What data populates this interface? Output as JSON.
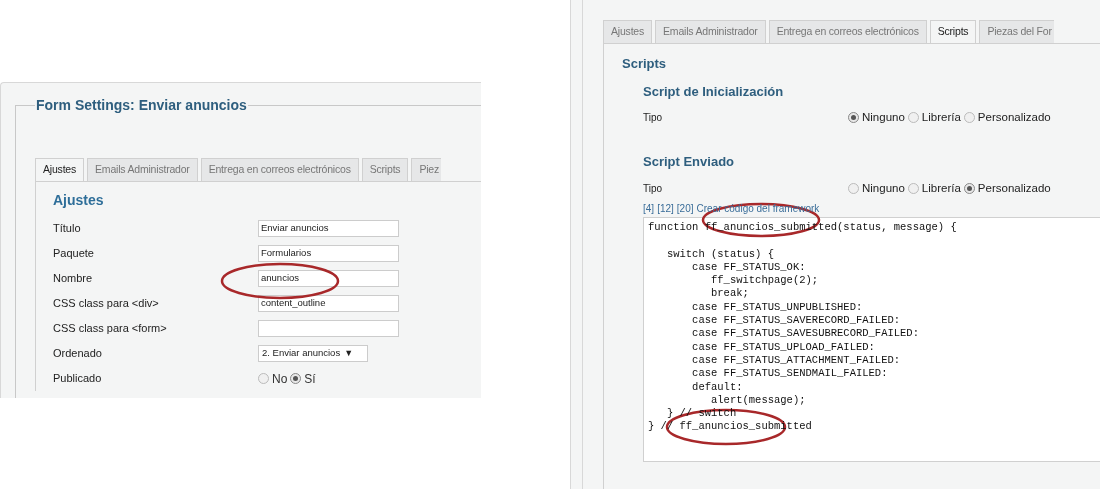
{
  "left_panel": {
    "legend": "Form Settings: Enviar anuncios",
    "tabs": [
      {
        "label": "Ajustes",
        "selected": true
      },
      {
        "label": "Emails Administrador",
        "selected": false
      },
      {
        "label": "Entrega en correos electrónicos",
        "selected": false
      },
      {
        "label": "Scripts",
        "selected": false
      },
      {
        "label": "Piez",
        "selected": false
      }
    ],
    "section_title": "Ajustes",
    "fields": [
      {
        "label": "Título",
        "kind": "text",
        "value": "Enviar anuncios"
      },
      {
        "label": "Paquete",
        "kind": "text",
        "value": "Formularios"
      },
      {
        "label": "Nombre",
        "kind": "text",
        "value": "anuncios"
      },
      {
        "label": "CSS class para <div>",
        "kind": "text",
        "value": "content_outline"
      },
      {
        "label": "CSS class para <form>",
        "kind": "text"
      },
      {
        "label": "Ordenado",
        "kind": "select",
        "value": "2. Enviar anuncios",
        "caret": "▼"
      },
      {
        "label": "Publicado",
        "kind": "radio",
        "options": [
          {
            "label": "No",
            "selected": false
          },
          {
            "label": "Sí",
            "selected": true
          }
        ]
      }
    ]
  },
  "right_panel": {
    "tabs": [
      {
        "label": "Ajustes",
        "selected": false
      },
      {
        "label": "Emails Administrador",
        "selected": false
      },
      {
        "label": "Entrega en correos electrónicos",
        "selected": false
      },
      {
        "label": "Scripts",
        "selected": true
      },
      {
        "label": "Piezas del For",
        "selected": false
      }
    ],
    "section_title": "Scripts",
    "scripts": [
      {
        "title": "Script de Inicialización",
        "field_label": "Tipo",
        "options": [
          {
            "label": "Ninguno",
            "selected": true
          },
          {
            "label": "Librería",
            "selected": false
          },
          {
            "label": "Personalizado",
            "selected": false
          }
        ]
      },
      {
        "title": "Script Enviado",
        "field_label": "Tipo",
        "options": [
          {
            "label": "Ninguno",
            "selected": false
          },
          {
            "label": "Librería",
            "selected": false
          },
          {
            "label": "Personalizado",
            "selected": true
          }
        ]
      }
    ],
    "code_links": [
      "[4]",
      "[12]",
      "[20]",
      "Crear código del framework"
    ],
    "code_lines": [
      {
        "kind": "code",
        "text": "function ff_anuncios_submitted(status, message) {"
      },
      {
        "kind": "blank"
      },
      {
        "kind": "code",
        "text": "   switch (status) {"
      },
      {
        "kind": "code",
        "text": "       case FF_STATUS_OK:"
      },
      {
        "kind": "code",
        "text": "          ff_switchpage(2);"
      },
      {
        "kind": "code",
        "text": "          break;"
      },
      {
        "kind": "code",
        "text": "       case FF_STATUS_UNPUBLISHED:"
      },
      {
        "kind": "code",
        "text": "       case FF_STATUS_SAVERECORD_FAILED:"
      },
      {
        "kind": "code",
        "text": "       case FF_STATUS_SAVESUBRECORD_FAILED:"
      },
      {
        "kind": "code",
        "text": "       case FF_STATUS_UPLOAD_FAILED:"
      },
      {
        "kind": "code",
        "text": "       case FF_STATUS_ATTACHMENT_FAILED:"
      },
      {
        "kind": "code",
        "text": "       case FF_STATUS_SENDMAIL_FAILED:"
      },
      {
        "kind": "code",
        "text": "       default:"
      },
      {
        "kind": "code",
        "text": "          alert(message);"
      },
      {
        "kind": "code",
        "text": "   } // switch"
      },
      {
        "kind": "code",
        "text": "} // ff_anuncios_submitted"
      }
    ]
  }
}
